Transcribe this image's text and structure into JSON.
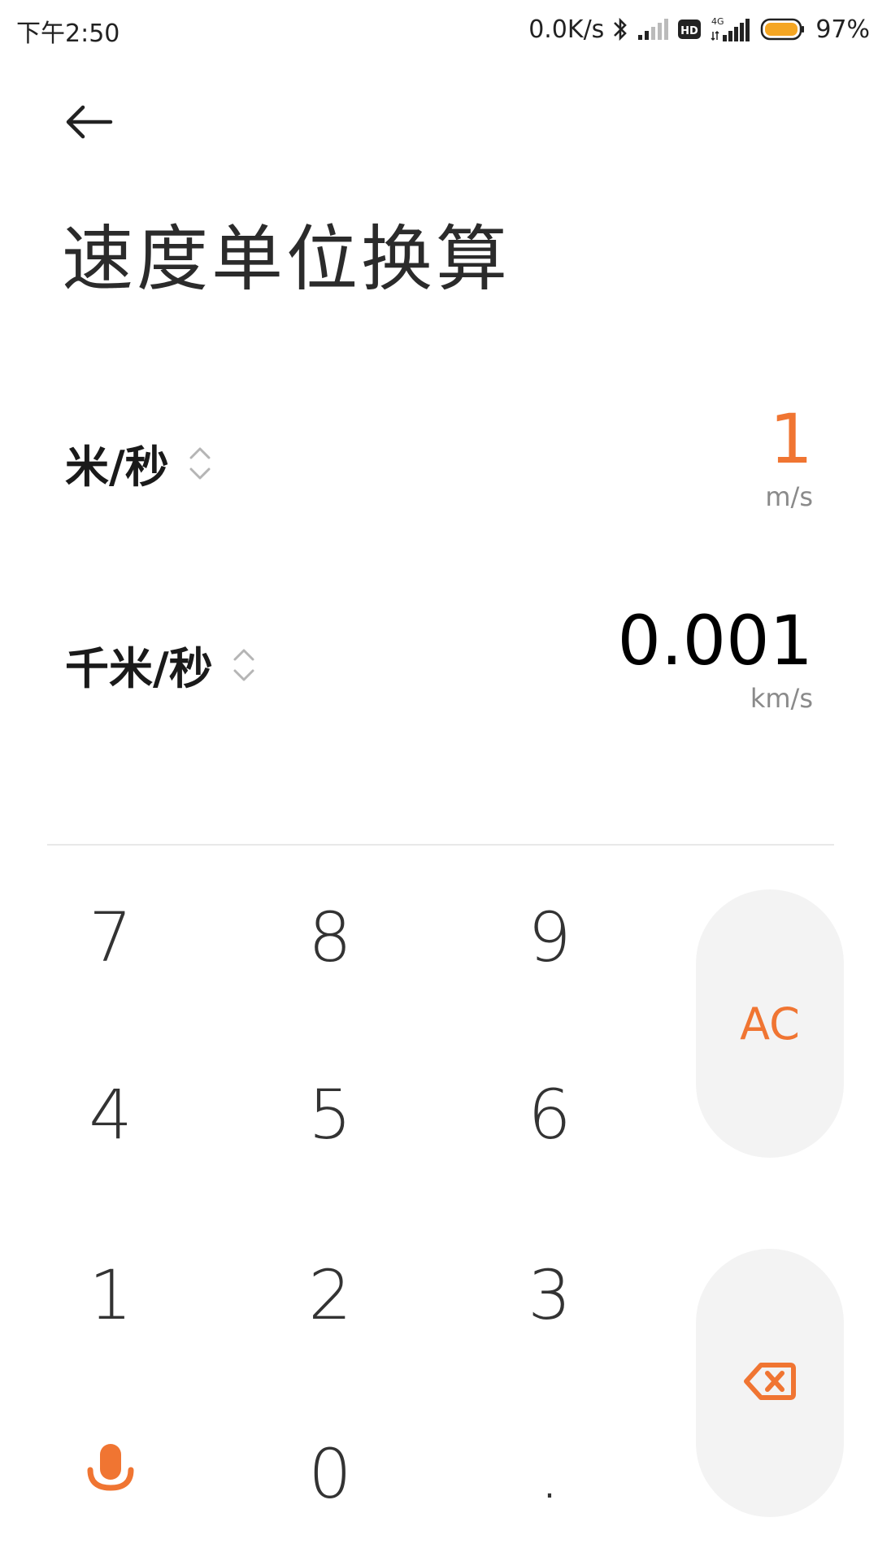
{
  "status_bar": {
    "time": "下午2:50",
    "network_speed": "0.0K/s",
    "network_type": "4G",
    "hd_label": "HD",
    "battery_percent": "97%",
    "battery_level": 0.97,
    "icons": [
      "bluetooth-icon",
      "signal-icon",
      "hd-icon",
      "signal-4g-icon",
      "battery-icon"
    ]
  },
  "header": {
    "back_icon": "arrow-left-icon",
    "title": "速度单位换算"
  },
  "converter": {
    "from": {
      "unit_name": "米/秒",
      "value": "1",
      "abbr": "m/s"
    },
    "to": {
      "unit_name": "千米/秒",
      "value": "0.001",
      "abbr": "km/s"
    }
  },
  "keypad": {
    "keys": {
      "k7": "7",
      "k8": "8",
      "k9": "9",
      "k4": "4",
      "k5": "5",
      "k6": "6",
      "k1": "1",
      "k2": "2",
      "k3": "3",
      "k0": "0",
      "dot": "."
    },
    "clear_label": "AC",
    "mic_icon": "microphone-icon",
    "backspace_icon": "backspace-icon"
  },
  "colors": {
    "accent": "#f07532",
    "text_primary": "#1a1a1a",
    "text_secondary": "#8a8a8a",
    "key_bg": "#f3f3f3",
    "divider": "#e8e8e8"
  }
}
